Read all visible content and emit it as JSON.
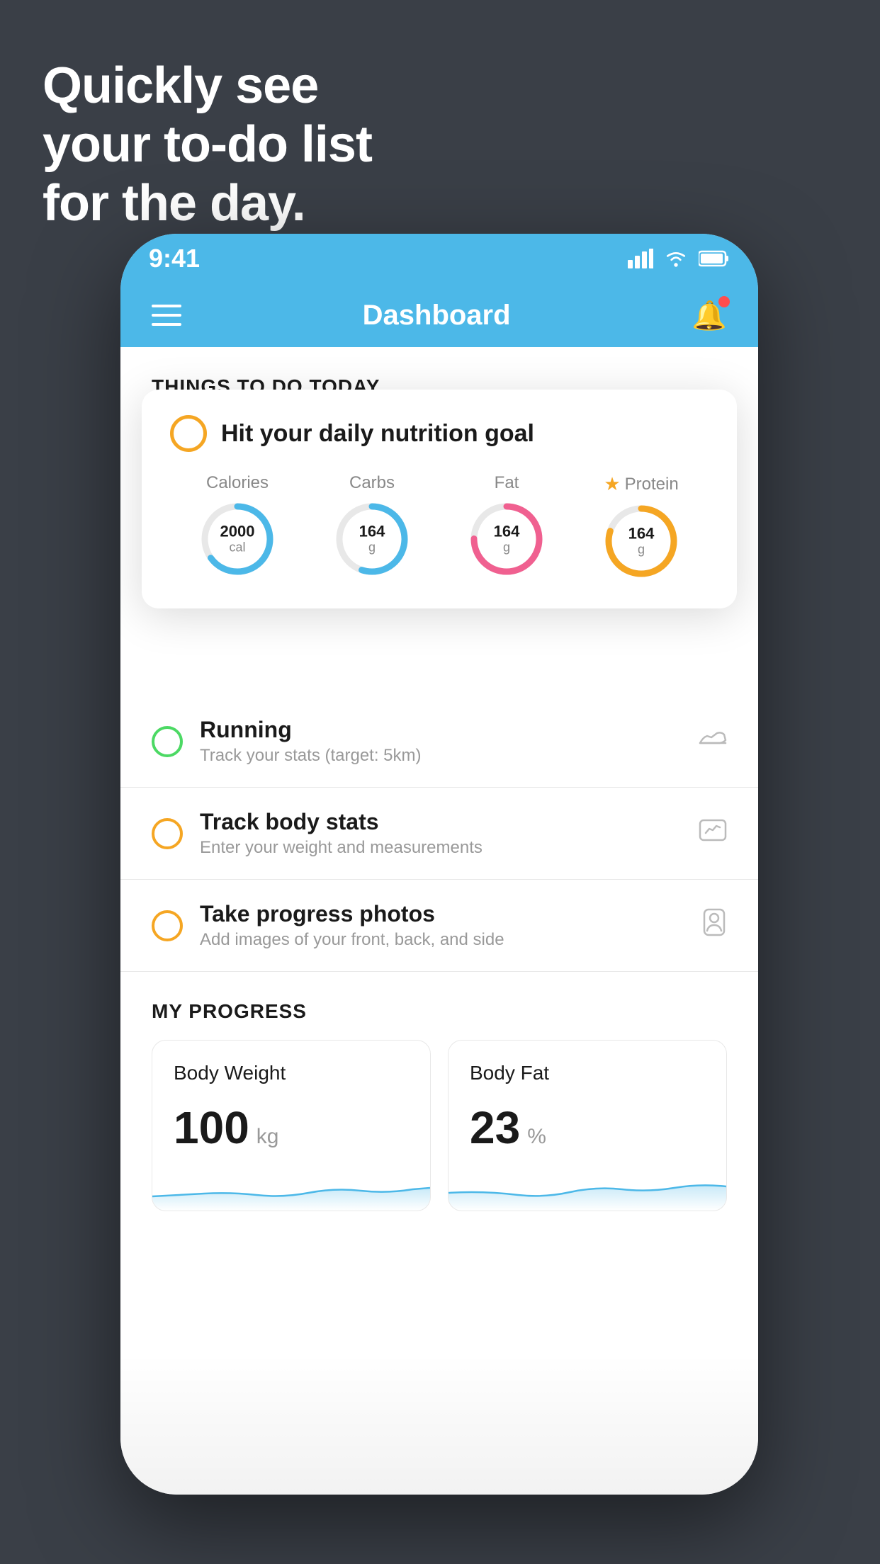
{
  "headline": {
    "line1": "Quickly see",
    "line2": "your to-do list",
    "line3": "for the day."
  },
  "status_bar": {
    "time": "9:41",
    "signal": "▋▋▋▋",
    "wifi": "wifi",
    "battery": "battery"
  },
  "nav": {
    "title": "Dashboard"
  },
  "section": {
    "things_today": "THINGS TO DO TODAY"
  },
  "floating_card": {
    "title": "Hit your daily nutrition goal",
    "nutrition": [
      {
        "label": "Calories",
        "value": "2000",
        "unit": "cal",
        "color": "#4cb8e8",
        "progress": 0.65
      },
      {
        "label": "Carbs",
        "value": "164",
        "unit": "g",
        "color": "#4cb8e8",
        "progress": 0.55
      },
      {
        "label": "Fat",
        "value": "164",
        "unit": "g",
        "color": "#f06090",
        "progress": 0.75
      },
      {
        "label": "Protein",
        "value": "164",
        "unit": "g",
        "color": "#f5a623",
        "progress": 0.8,
        "starred": true
      }
    ]
  },
  "todo_items": [
    {
      "title": "Running",
      "subtitle": "Track your stats (target: 5km)",
      "circle_color": "green",
      "icon": "shoe"
    },
    {
      "title": "Track body stats",
      "subtitle": "Enter your weight and measurements",
      "circle_color": "yellow",
      "icon": "scale"
    },
    {
      "title": "Take progress photos",
      "subtitle": "Add images of your front, back, and side",
      "circle_color": "yellow",
      "icon": "person"
    }
  ],
  "progress": {
    "header": "MY PROGRESS",
    "cards": [
      {
        "title": "Body Weight",
        "value": "100",
        "unit": "kg"
      },
      {
        "title": "Body Fat",
        "value": "23",
        "unit": "%"
      }
    ]
  }
}
